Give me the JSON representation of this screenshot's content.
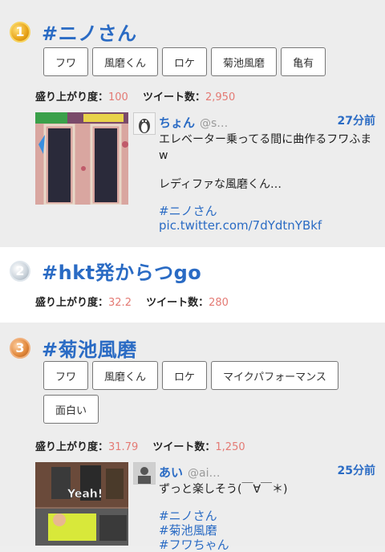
{
  "ranks": [
    {
      "rank": "1",
      "title": "#ニノさん",
      "tags": [
        "フワ",
        "風磨くん",
        "ロケ",
        "菊池風磨",
        "亀有"
      ],
      "stats": {
        "excitement_label": "盛り上がり度：",
        "excitement": "100",
        "tweets_label": "ツイート数：",
        "tweets": "2,950"
      },
      "tweet": {
        "user": "ちょん",
        "handle": "@s…",
        "time": "27分前",
        "line1": "エレベーター乗ってる間に曲作るフワふま",
        "line2": "w",
        "line3": "レディファな風磨くん…",
        "hashtag": "#ニノさん",
        "link": "pic.twitter.com/7dYdtnYBkf"
      }
    },
    {
      "rank": "2",
      "title": "#hkt発からつgo",
      "stats": {
        "excitement_label": "盛り上がり度：",
        "excitement": "32.2",
        "tweets_label": "ツイート数：",
        "tweets": "280"
      }
    },
    {
      "rank": "3",
      "title": "#菊池風磨",
      "tags": [
        "フワ",
        "風磨くん",
        "ロケ",
        "マイクパフォーマンス",
        "面白い"
      ],
      "stats": {
        "excitement_label": "盛り上がり度：",
        "excitement": "31.79",
        "tweets_label": "ツイート数：",
        "tweets": "1,250"
      },
      "tweet": {
        "user": "あい",
        "handle": "@ai…",
        "time": "25分前",
        "line1": "ずっと楽しそう(￣∀￣＊)",
        "hashtags": [
          "#ニノさん",
          "#菊池風磨",
          "#フワちゃん"
        ],
        "thumb_text": "Yeah!"
      }
    }
  ]
}
